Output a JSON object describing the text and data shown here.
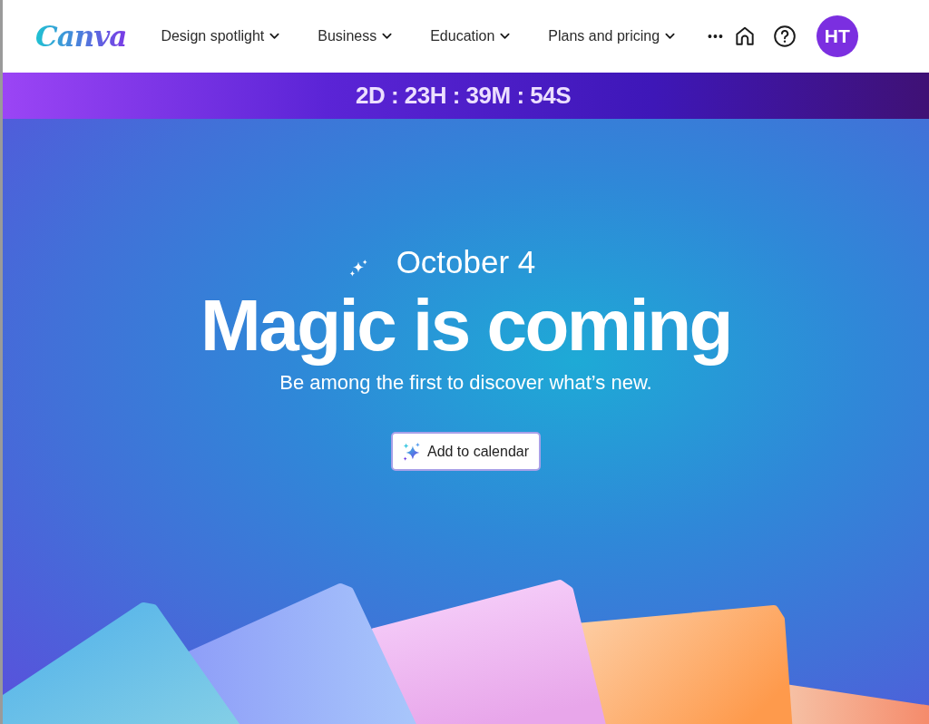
{
  "header": {
    "logo": "Canva",
    "nav": [
      {
        "label": "Design spotlight"
      },
      {
        "label": "Business"
      },
      {
        "label": "Education"
      },
      {
        "label": "Plans and pricing"
      }
    ],
    "more": "•••",
    "avatar": "HT"
  },
  "countdown": "2D : 23H : 39M : 54S",
  "hero": {
    "date": "October 4",
    "title": "Magic is coming",
    "subtitle": "Be among the first to discover what’s new.",
    "button": "Add to calendar"
  }
}
